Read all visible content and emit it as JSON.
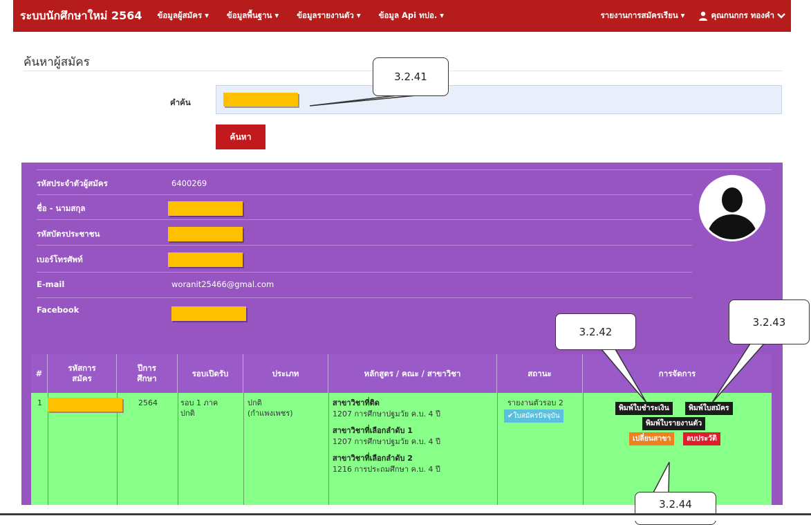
{
  "navbar": {
    "brand": "ระบบนักศึกษาใหม่ 2564",
    "items": [
      {
        "label": "ข้อมูลผู้สมัคร ▾"
      },
      {
        "label": "ข้อมูลพื้นฐาน ▾"
      },
      {
        "label": "ข้อมูลรายงานตัว ▾"
      },
      {
        "label": "ข้อมูล Api ทปอ. ▾"
      }
    ],
    "report_menu": "รายงานการสมัครเรียน ▾",
    "user_name": "คุณกนกกร ทองคำ",
    "accent": "#b71c1c"
  },
  "page": {
    "title": "ค้นหาผู้สมัคร",
    "search_label": "คำค้น",
    "search_button": "ค้นหา"
  },
  "profile": {
    "applicant_id_label": "รหัสประจำตัวผู้สมัคร",
    "applicant_id": "6400269",
    "name_label": "ชื่อ - นามสกุล",
    "national_id_label": "รหัสบัตรประชาชน",
    "phone_label": "เบอร์โทรศัพท์",
    "email_label": "E-mail",
    "email": "woranit25466@gmal.com",
    "facebook_label": "Facebook",
    "panel_color": "#9755c1",
    "redaction_color": "#ffc000"
  },
  "table": {
    "headers": {
      "num": "#",
      "app_code": "รหัสการ\nสมัคร",
      "year": "ปีการ\nศึกษา",
      "round": "รอบเปิดรับ",
      "type": "ประเภท",
      "program": "หลักสูตร / คณะ / สาขาวิชา",
      "status": "สถานะ",
      "actions": "การจัดการ"
    },
    "row": {
      "num": "1",
      "year": "2564",
      "round": "รอบ 1 ภาค\nปกติ",
      "type": "ปกติ\n(กำแพงเพชร)",
      "passed_title": "สาขาวิชาที่ติด",
      "passed_value": "1207 การศึกษาปฐมวัย ค.บ. 4 ปี",
      "choice1_title": "สาขาวิชาที่เลือกลำดับ 1",
      "choice1_value": "1207 การศึกษาปฐมวัย ค.บ. 4 ปี",
      "choice2_title": "สาขาวิชาที่เลือกลำดับ 2",
      "choice2_value": "1216 การประถมศึกษา ค.บ. 4 ปี",
      "status_text": "รายงานตัวรอบ 2",
      "status_badge": "✔ใบสมัครปัจจุบัน",
      "btn_payment": "พิมพ์ใบชำระเงิน",
      "btn_application": "พิมพ์ใบสมัคร",
      "btn_report": "พิมพ์ใบรายงานตัว",
      "btn_change_major": "เปลี่ยนสาขา",
      "btn_delete_history": "ลบประวัติ"
    }
  },
  "callouts": {
    "c1": "3.2.41",
    "c2": "3.2.42",
    "c3": "3.2.43",
    "c4": "3.2.44"
  }
}
